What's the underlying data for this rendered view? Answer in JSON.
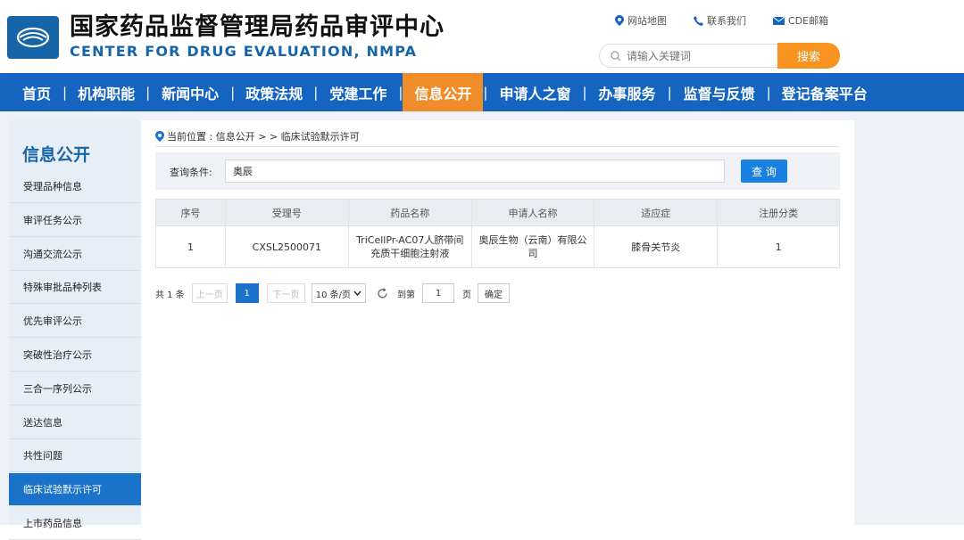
{
  "header": {
    "title_cn": "国家药品监督管理局药品审评中心",
    "title_en": "CENTER FOR DRUG EVALUATION, NMPA",
    "links": [
      {
        "label": "网站地图",
        "icon": "location-pin-icon"
      },
      {
        "label": "联系我们",
        "icon": "phone-icon"
      },
      {
        "label": "CDE邮箱",
        "icon": "mail-icon"
      }
    ],
    "search_placeholder": "请输入关键词",
    "search_button": "搜索"
  },
  "nav": {
    "items": [
      "首页",
      "机构职能",
      "新闻中心",
      "政策法规",
      "党建工作",
      "信息公开",
      "申请人之窗",
      "办事服务",
      "监督与反馈",
      "登记备案平台"
    ],
    "active_index": 5
  },
  "sidebar": {
    "title": "信息公开",
    "items": [
      "受理品种信息",
      "审评任务公示",
      "沟通交流公示",
      "特殊审批品种列表",
      "优先审评公示",
      "突破性治疗公示",
      "三合一序列公示",
      "送达信息",
      "共性问题",
      "临床试验默示许可",
      "上市药品信息"
    ],
    "active_index": 9
  },
  "main": {
    "breadcrumb": "当前位置 : 信息公开 > > 临床试验默示许可",
    "query_label": "查询条件:",
    "query_value": "奥辰",
    "query_button": "查 询",
    "table": {
      "headers": [
        "序号",
        "受理号",
        "药品名称",
        "申请人名称",
        "适应症",
        "注册分类"
      ],
      "rows": [
        [
          "1",
          "CXSL2500071",
          "TriCellPr-AC07人脐带间充质干细胞注射液",
          "奥辰生物（云南）有限公司",
          "膝骨关节炎",
          "1"
        ]
      ]
    },
    "pager": {
      "total": "共 1 条",
      "prev": "上一页",
      "current": "1",
      "next": "下一页",
      "page_size": "10 条/页",
      "goto_label": "到第",
      "goto_value": "1",
      "page_unit": "页",
      "confirm": "确定"
    }
  },
  "colors": {
    "brand_blue": "#1565c0",
    "accent_orange": "#f08c2a",
    "button_blue": "#1a80e0"
  }
}
